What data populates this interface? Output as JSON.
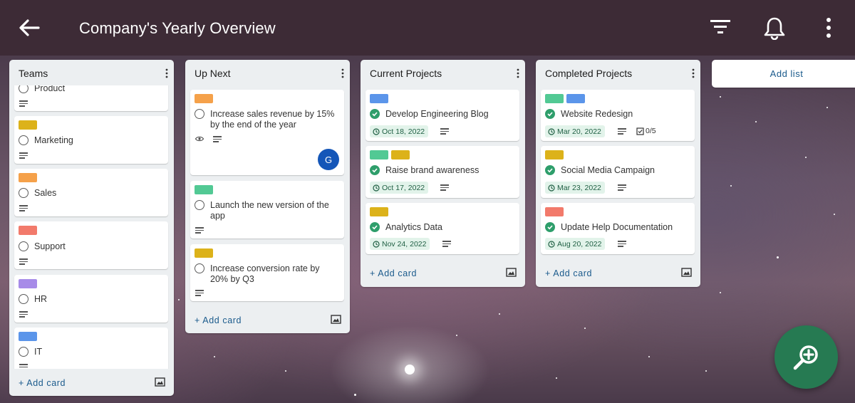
{
  "header": {
    "title": "Company's Yearly Overview",
    "back_icon": "arrow-left-icon",
    "filter_icon": "filter-icon",
    "notifications_icon": "bell-icon",
    "more_icon": "more-vertical-icon"
  },
  "colors": {
    "appbar": "#3d2b36",
    "accent_link": "#1a5a8c",
    "label_orange": "#f5a14a",
    "label_yellow": "#dcb21a",
    "label_red": "#f27a6b",
    "label_purple": "#a78be8",
    "label_blue": "#5b95ea",
    "label_green": "#52c994",
    "complete_green": "#2e9e6b",
    "fab": "#267a52",
    "avatar": "#1456b8"
  },
  "lists": [
    {
      "title": "Teams",
      "cards": [
        {
          "title": "Product"
        },
        {
          "title": "Marketing"
        },
        {
          "title": "Sales"
        },
        {
          "title": "Support"
        },
        {
          "title": "HR"
        },
        {
          "title": "IT"
        }
      ],
      "add_card_label": "+ Add card"
    },
    {
      "title": "Up Next",
      "cards": [
        {
          "title": "Increase sales revenue by 15% by the end of the year",
          "avatar": "G"
        },
        {
          "title": "Launch the new version of the app"
        },
        {
          "title": "Increase conversion rate by 20% by Q3"
        }
      ],
      "add_card_label": "+ Add card"
    },
    {
      "title": "Current Projects",
      "cards": [
        {
          "title": "Develop Engineering Blog",
          "due": "Oct 18, 2022"
        },
        {
          "title": "Raise brand awareness",
          "due": "Oct 17, 2022"
        },
        {
          "title": "Analytics Data",
          "due": "Nov 24, 2022"
        }
      ],
      "add_card_label": "+ Add card"
    },
    {
      "title": "Completed Projects",
      "cards": [
        {
          "title": "Website Redesign",
          "due": "Mar 20, 2022",
          "checklist": "0/5"
        },
        {
          "title": "Social Media Campaign",
          "due": "Mar 23, 2022"
        },
        {
          "title": "Update Help Documentation",
          "due": "Aug 20, 2022"
        }
      ],
      "add_card_label": "+ Add card"
    }
  ],
  "add_list_label": "Add list",
  "fab": {
    "icon": "zoom-in-icon"
  }
}
